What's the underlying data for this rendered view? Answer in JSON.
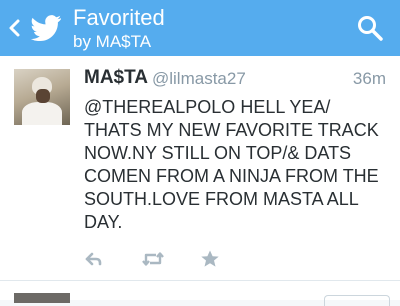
{
  "header": {
    "title": "Favorited",
    "subtitle": "by MA$TA",
    "back_icon": "back-chevron-icon",
    "logo_icon": "twitter-bird-icon",
    "search_icon": "search-icon",
    "bg_color": "#55acee"
  },
  "tweet": {
    "author_name": "MA$TA",
    "author_handle": "@lilmasta27",
    "timestamp": "36m",
    "text": "@THEREALPOLO HELL YEA/ THATS MY NEW FAVORITE TRACK NOW.NY STILL ON TOP/& DATS COMEN FROM A NINJA FROM THE SOUTH.LOVE FROM MASTA ALL DAY.",
    "actions": [
      {
        "icon": "reply-icon"
      },
      {
        "icon": "retweet-icon"
      },
      {
        "icon": "favorite-star-icon"
      }
    ]
  }
}
